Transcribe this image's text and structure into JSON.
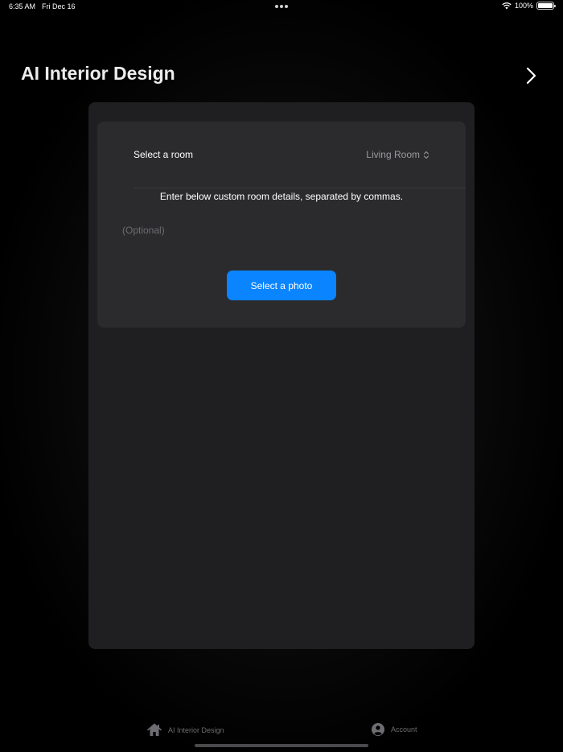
{
  "status_bar": {
    "time": "6:35 AM",
    "date": "Fri Dec 16",
    "battery": "100%",
    "battery_level": 1.0,
    "icons": [
      "wifi-icon",
      "battery-icon",
      "multitasking-dots-icon"
    ]
  },
  "navigation": {
    "title": "AI Interior Design",
    "forward_icon": "chevron-right-icon"
  },
  "form": {
    "room_label": "Select a room",
    "room_value": "Living Room",
    "room_picker_icon": "chevron-up-down-icon",
    "instructions": "Enter below custom room details, separated by commas.",
    "details_placeholder": "(Optional)",
    "details_value": "",
    "select_photo_label": "Select a photo"
  },
  "tab_bar": {
    "items": [
      {
        "label": "AI Interior Design",
        "icon": "house-icon"
      },
      {
        "label": "Account",
        "icon": "person-circle-icon"
      }
    ]
  },
  "colors": {
    "accent": "#0a84ff",
    "background": "#000000",
    "panel": "#1f1f21",
    "card": "#2b2b2d",
    "secondary_text": "#9a9a9e"
  }
}
